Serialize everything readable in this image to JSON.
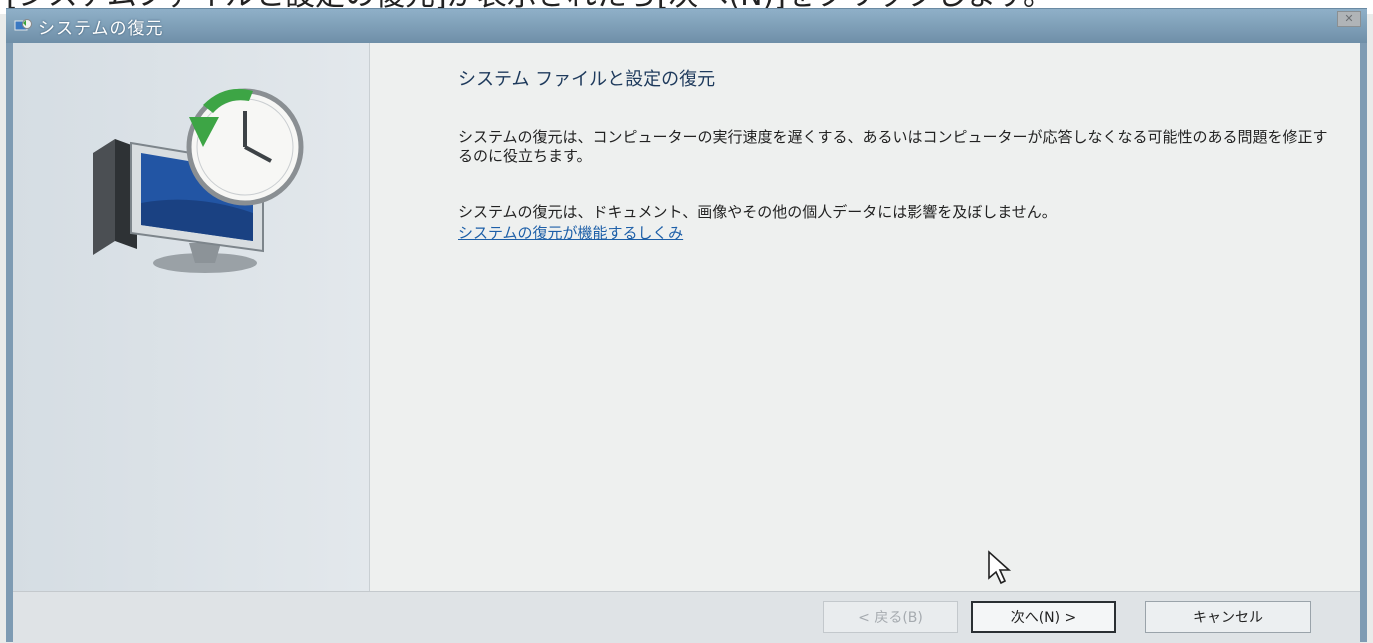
{
  "caption": {
    "text": "[システムファイルと設定の復元]が表示されたら[次へ(N)]をクリックします。"
  },
  "window": {
    "title": "システムの復元",
    "close_label": "✕"
  },
  "content": {
    "heading": "システム ファイルと設定の復元",
    "paragraph1": "システムの復元は、コンピューターの実行速度を遅くする、あるいはコンピューターが応答しなくなる可能性のある問題を修正するのに役立ちます。",
    "paragraph2": "システムの復元は、ドキュメント、画像やその他の個人データには影響を及ぼしません。",
    "link": "システムの復元が機能するしくみ"
  },
  "buttons": {
    "back": "< 戻る(B)",
    "next": "次へ(N) >",
    "cancel": "キャンセル"
  },
  "icons": {
    "window_icon": "system-restore-icon",
    "illustration": "system-restore-clock-monitor-icon",
    "cursor": "mouse-pointer-icon"
  },
  "colors": {
    "titlebar": "#7e9bb3",
    "link": "#1d5fa8",
    "heading": "#1e3a5c"
  }
}
